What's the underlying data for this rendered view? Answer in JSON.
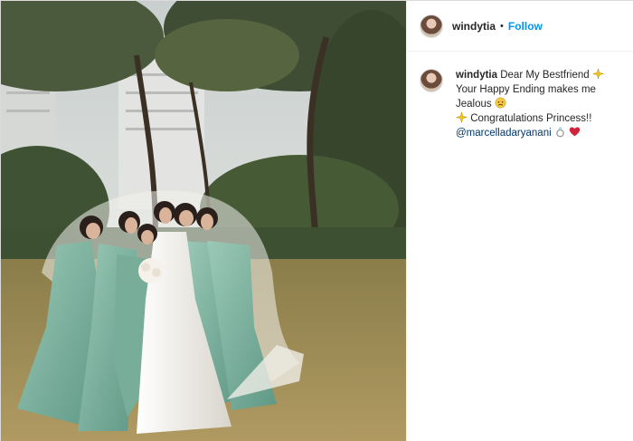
{
  "post": {
    "author": "windytia",
    "follow_label": "Follow",
    "separator": "•",
    "avatar_icon": "profile-avatar"
  },
  "caption": {
    "author": "windytia",
    "line1": "Dear My Bestfriend",
    "line2": "Your Happy Ending makes me Jealous",
    "line3": "Congratulations Princess!!",
    "mention": "@marcelladaryanani",
    "emojis": [
      "sparkles-icon",
      "sparkles-icon",
      "worried-face-icon",
      "ring-icon",
      "heart-icon"
    ]
  },
  "colors": {
    "follow": "#0095f6",
    "mention": "#00376b",
    "text": "#262626",
    "dress_green": "#7fb3a0",
    "gown_white": "#f4f2ee",
    "grass": "#a08a55"
  }
}
